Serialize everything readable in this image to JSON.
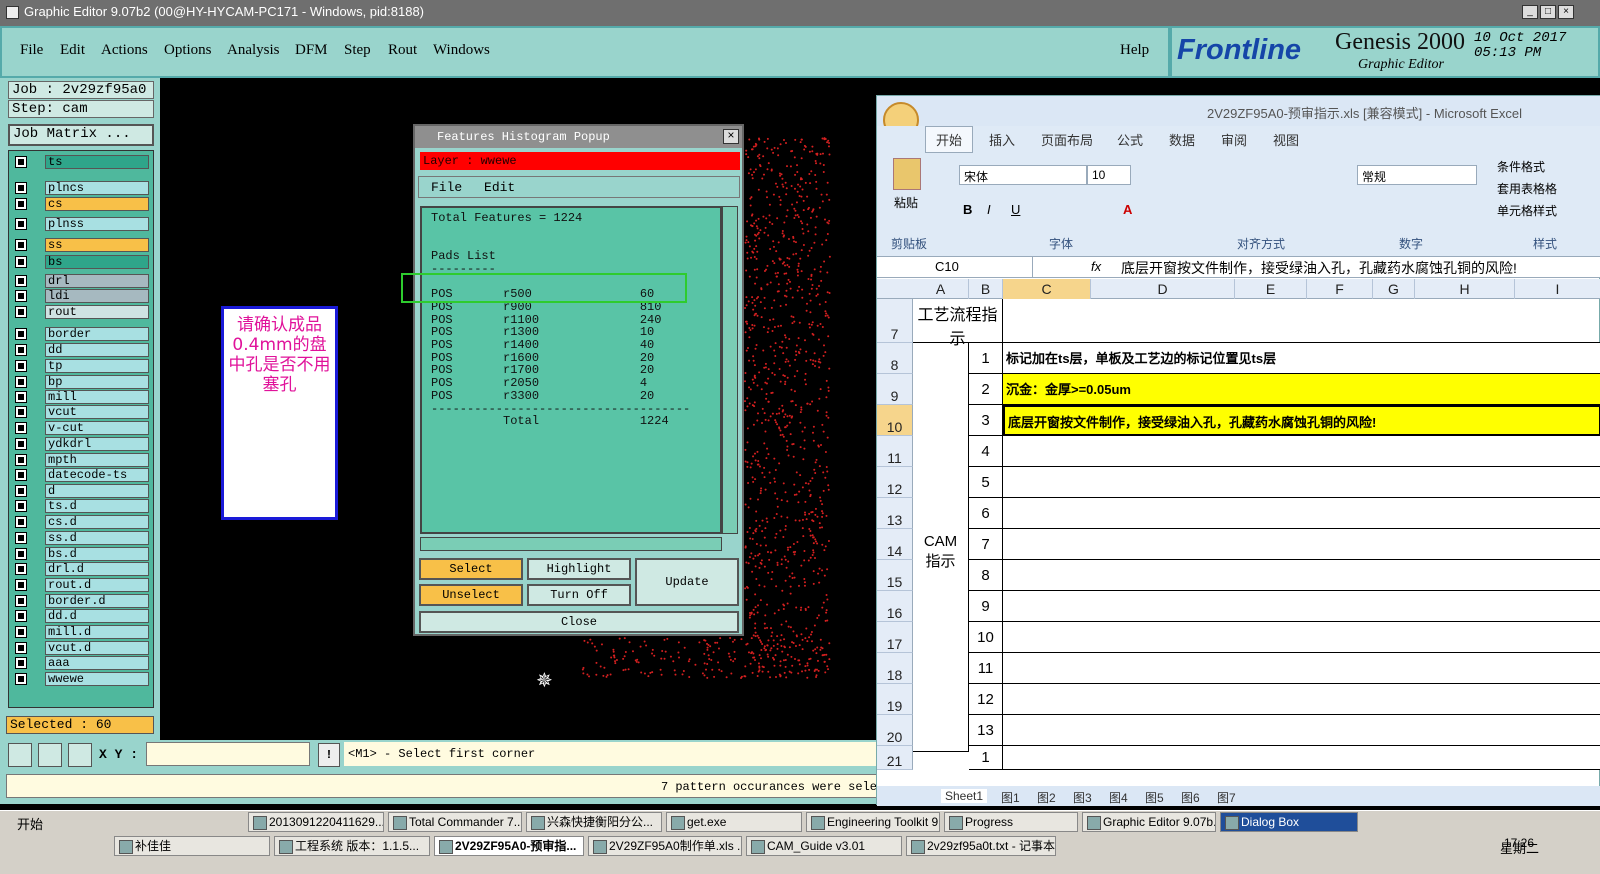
{
  "genesis": {
    "title": "Graphic Editor 9.07b2 (00@HY-HYCAM-PC171 - Windows, pid:8188)",
    "menu": [
      "File",
      "Edit",
      "Actions",
      "Options",
      "Analysis",
      "DFM",
      "Step",
      "Rout",
      "Windows"
    ],
    "help": "Help",
    "brand": "Frontline",
    "product": "Genesis 2000",
    "subtitle": "Graphic Editor",
    "date": "10 Oct 2017",
    "time": "05:13 PM",
    "job": "Job : 2v29zf95a0",
    "step": "Step: cam",
    "job_matrix": "Job Matrix ...",
    "layers": [
      {
        "name": "ts",
        "color": "#2fa58a"
      },
      {
        "name": "plncs",
        "color": "#a8e0e2"
      },
      {
        "name": "cs",
        "color": "#f8c048"
      },
      {
        "name": "plnss",
        "color": "#a8e0e2"
      },
      {
        "name": "ss",
        "color": "#f8c048"
      },
      {
        "name": "bs",
        "color": "#2fa58a"
      },
      {
        "name": "drl",
        "color": "#a6b9c0"
      },
      {
        "name": "ldi",
        "color": "#a6b9c0"
      },
      {
        "name": "rout",
        "color": "#cfe3e3"
      },
      {
        "name": "border",
        "color": "#a8e0e2"
      },
      {
        "name": "dd",
        "color": "#a8e0e2"
      },
      {
        "name": "tp",
        "color": "#a8e0e2"
      },
      {
        "name": "bp",
        "color": "#a8e0e2"
      },
      {
        "name": "mill",
        "color": "#a8e0e2"
      },
      {
        "name": "vcut",
        "color": "#a8e0e2"
      },
      {
        "name": "v-cut",
        "color": "#a8e0e2"
      },
      {
        "name": "ydkdrl",
        "color": "#a8e0e2"
      },
      {
        "name": "mpth",
        "color": "#a8e0e2"
      },
      {
        "name": "datecode-ts",
        "color": "#a8e0e2"
      },
      {
        "name": "d",
        "color": "#a8e0e2"
      },
      {
        "name": "ts.d",
        "color": "#a8e0e2"
      },
      {
        "name": "cs.d",
        "color": "#a8e0e2"
      },
      {
        "name": "ss.d",
        "color": "#a8e0e2"
      },
      {
        "name": "bs.d",
        "color": "#a8e0e2"
      },
      {
        "name": "drl.d",
        "color": "#a8e0e2"
      },
      {
        "name": "rout.d",
        "color": "#a8e0e2"
      },
      {
        "name": "border.d",
        "color": "#a8e0e2"
      },
      {
        "name": "dd.d",
        "color": "#a8e0e2"
      },
      {
        "name": "mill.d",
        "color": "#a8e0e2"
      },
      {
        "name": "vcut.d",
        "color": "#a8e0e2"
      },
      {
        "name": "aaa",
        "color": "#a8e0e2"
      },
      {
        "name": "wwewe",
        "color": "#a8e0e2"
      }
    ],
    "selected": "Selected : 60",
    "xy_label": "X Y :",
    "prompt": "<M1> - Select first corner",
    "status": "7 pattern occurances were sele",
    "note": "请确认成品0.4mm的盘中孔是否不用塞孔"
  },
  "histogram": {
    "title": "Features Histogram Popup",
    "layer": "Layer :  wwewe",
    "menu": [
      "File",
      "Edit"
    ],
    "text": "Total Features = 1224\n\n\nPads List\n---------\n\nPOS       r500               60\nPOS       r900               810\nPOS       r1100              240\nPOS       r1300              10\nPOS       r1400              40\nPOS       r1600              20\nPOS       r1700              20\nPOS       r2050              4\nPOS       r3300              20\n------------------------------------\n          Total              1224",
    "buttons": {
      "select": "Select",
      "highlight": "Highlight",
      "update": "Update",
      "unselect": "Unselect",
      "turnoff": "Turn Off",
      "close": "Close"
    }
  },
  "excel": {
    "title": "2V29ZF95A0-预审指示.xls  [兼容模式] - Microsoft Excel",
    "tabs": [
      "开始",
      "插入",
      "页面布局",
      "公式",
      "数据",
      "审阅",
      "视图"
    ],
    "font": "宋体",
    "size": "10",
    "numfmt": "常规",
    "groups": [
      "剪贴板",
      "字体",
      "对齐方式",
      "数字",
      "样式"
    ],
    "side": [
      "条件格式",
      "套用表格格",
      "单元格样式"
    ],
    "paste": "粘贴",
    "namebox": "C10",
    "formula": "底层开窗按文件制作，接受绿油入孔，孔藏药水腐蚀孔铜的风险!",
    "cols": [
      "A",
      "B",
      "C",
      "D",
      "E",
      "F",
      "G",
      "H",
      "I"
    ],
    "rows": [
      "7",
      "8",
      "9",
      "10",
      "11",
      "12",
      "13",
      "14",
      "15",
      "16",
      "17",
      "18",
      "19",
      "20",
      "21"
    ],
    "header_cell": "工艺流程指示",
    "cam_cell": "CAM指示",
    "items": [
      {
        "n": "1",
        "t": "标记加在ts层，单板及工艺边的标记位置见ts层",
        "y": false
      },
      {
        "n": "2",
        "t": "沉金：金厚>=0.05um",
        "y": true
      },
      {
        "n": "3",
        "t": "底层开窗按文件制作，接受绿油入孔，孔藏药水腐蚀孔铜的风险!",
        "y": true
      },
      {
        "n": "4",
        "t": "",
        "y": false
      },
      {
        "n": "5",
        "t": "",
        "y": false
      },
      {
        "n": "6",
        "t": "",
        "y": false
      },
      {
        "n": "7",
        "t": "",
        "y": false
      },
      {
        "n": "8",
        "t": "",
        "y": false
      },
      {
        "n": "9",
        "t": "",
        "y": false
      },
      {
        "n": "10",
        "t": "",
        "y": false
      },
      {
        "n": "11",
        "t": "",
        "y": false
      },
      {
        "n": "12",
        "t": "",
        "y": false
      },
      {
        "n": "13",
        "t": "",
        "y": false
      },
      {
        "n": "1",
        "t": "",
        "y": false
      }
    ],
    "sheets": [
      "Sheet1",
      "图1",
      "图2",
      "图3",
      "图4",
      "图5",
      "图6",
      "图7"
    ]
  },
  "taskbar": {
    "start": "开始",
    "row1": [
      "2013091220411629...",
      "Total Commander 7....",
      "兴森快捷衡阳分公...",
      "get.exe",
      "Engineering Toolkit 9...",
      "Progress",
      "Graphic Editor 9.07b...",
      "Dialog Box"
    ],
    "row2": [
      "补佳佳",
      "工程系统  版本：1.1.5...",
      "2V29ZF95A0-预审指...",
      "2V29ZF95A0制作单.xls ...",
      "CAM_Guide v3.01",
      "2v29zf95a0t.txt - 记事本"
    ],
    "clock": "17:26",
    "day": "星期二"
  }
}
